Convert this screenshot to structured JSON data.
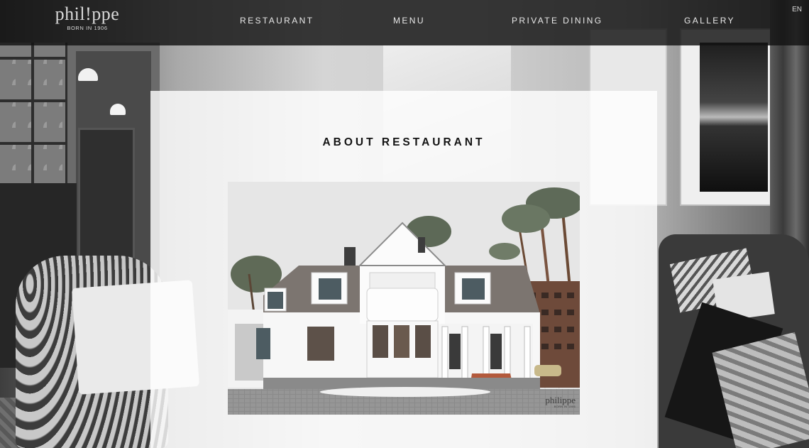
{
  "brand": {
    "name": "phil!ppe",
    "tagline": "BORN IN 1906"
  },
  "nav": {
    "items": [
      {
        "label": "RESTAURANT"
      },
      {
        "label": "MENU"
      },
      {
        "label": "PRIVATE DINING"
      },
      {
        "label": "GALLERY"
      }
    ],
    "language": "EN"
  },
  "about": {
    "heading": "ABOUT RESTAURANT"
  },
  "photo": {
    "watermark_name": "philippe",
    "watermark_sub": "BORN IN 1906"
  }
}
